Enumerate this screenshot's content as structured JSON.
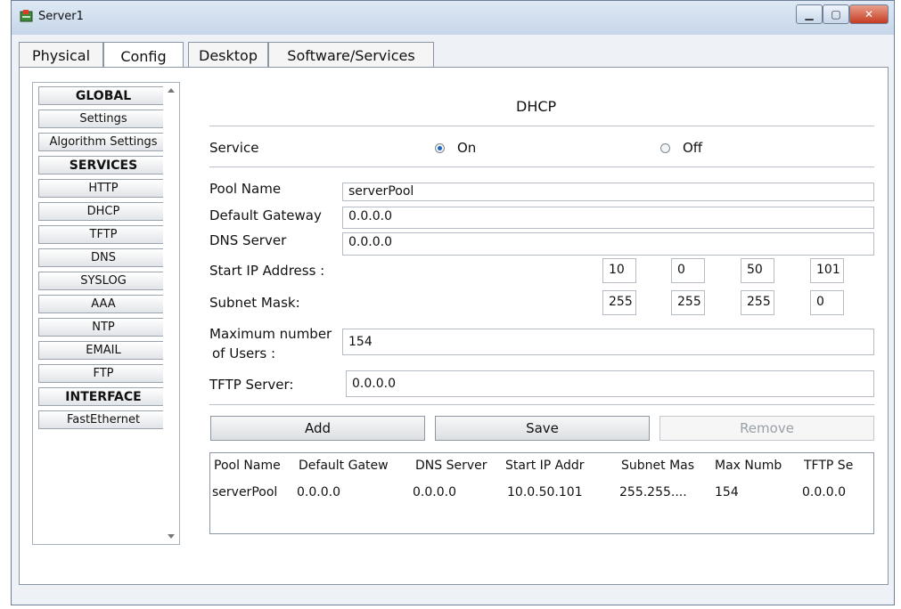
{
  "window": {
    "title": "Server1"
  },
  "tabs": [
    "Physical",
    "Config",
    "Desktop",
    "Software/Services"
  ],
  "sidebar": {
    "items": [
      {
        "label": "GLOBAL",
        "header": true
      },
      {
        "label": "Settings"
      },
      {
        "label": "Algorithm Settings"
      },
      {
        "label": "SERVICES",
        "header": true
      },
      {
        "label": "HTTP"
      },
      {
        "label": "DHCP"
      },
      {
        "label": "TFTP"
      },
      {
        "label": "DNS"
      },
      {
        "label": "SYSLOG"
      },
      {
        "label": "AAA"
      },
      {
        "label": "NTP"
      },
      {
        "label": "EMAIL"
      },
      {
        "label": "FTP"
      },
      {
        "label": "INTERFACE",
        "header": true
      },
      {
        "label": "FastEthernet"
      }
    ]
  },
  "dhcp": {
    "heading": "DHCP",
    "service_label": "Service",
    "on_label": "On",
    "off_label": "Off",
    "service_state": "On",
    "pool_name_label": "Pool Name",
    "pool_name": "serverPool",
    "default_gateway_label": "Default Gateway",
    "default_gateway": "0.0.0.0",
    "dns_server_label": "DNS Server",
    "dns_server": "0.0.0.0",
    "start_ip_label": "Start IP Address :",
    "start_ip": [
      "10",
      "0",
      "50",
      "101"
    ],
    "subnet_mask_label": "Subnet Mask:",
    "subnet_mask": [
      "255",
      "255",
      "255",
      "0"
    ],
    "max_users_label_1": "Maximum number",
    "max_users_label_2": "of Users :",
    "max_users": "154",
    "tftp_server_label": "TFTP Server:",
    "tftp_server": "0.0.0.0",
    "add_label": "Add",
    "save_label": "Save",
    "remove_label": "Remove"
  },
  "pool_table": {
    "headers": [
      "Pool Name",
      "Default Gatew",
      "DNS Server",
      "Start IP Addr",
      "Subnet Mas",
      "Max Numb",
      "TFTP Se"
    ],
    "rows": [
      [
        "serverPool",
        "0.0.0.0",
        "0.0.0.0",
        "10.0.50.101",
        "255.255....",
        "154",
        "0.0.0.0"
      ]
    ]
  }
}
